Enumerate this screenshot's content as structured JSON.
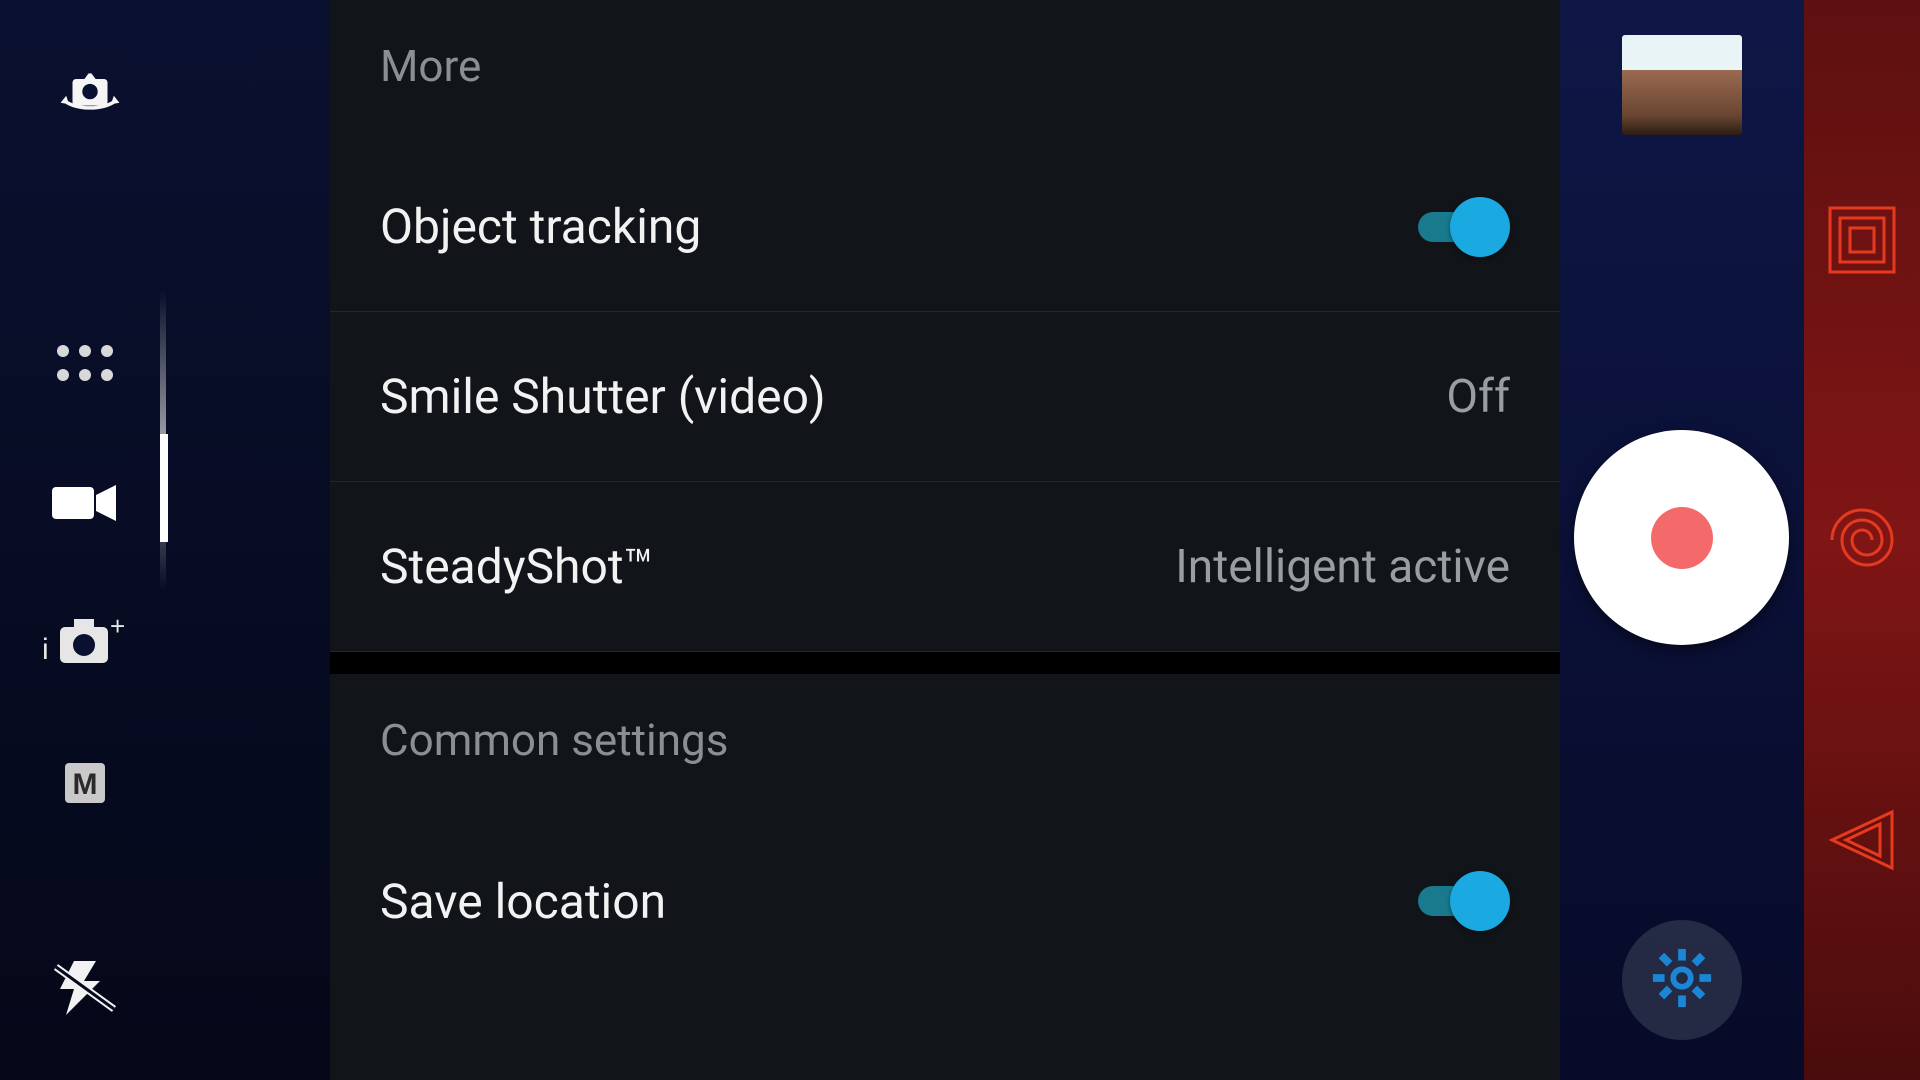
{
  "leftBar": {
    "switchCameraIcon": "switch-camera",
    "modes": {
      "apps": "apps",
      "video": "video",
      "superiorAuto": "superior-auto",
      "manual": "M"
    },
    "flash": "flash-off"
  },
  "sections": [
    {
      "title": "More",
      "rows": [
        {
          "label": "Object tracking",
          "type": "toggle",
          "on": true
        },
        {
          "label": "Smile Shutter (video)",
          "type": "value",
          "value": "Off"
        },
        {
          "label": "SteadyShot™",
          "type": "value",
          "value": "Intelligent active"
        }
      ]
    },
    {
      "title": "Common settings",
      "rows": [
        {
          "label": "Save location",
          "type": "toggle",
          "on": true
        }
      ]
    }
  ],
  "rightBar": {
    "thumbnail": "gallery-preview",
    "record": "record",
    "settings": "settings"
  }
}
